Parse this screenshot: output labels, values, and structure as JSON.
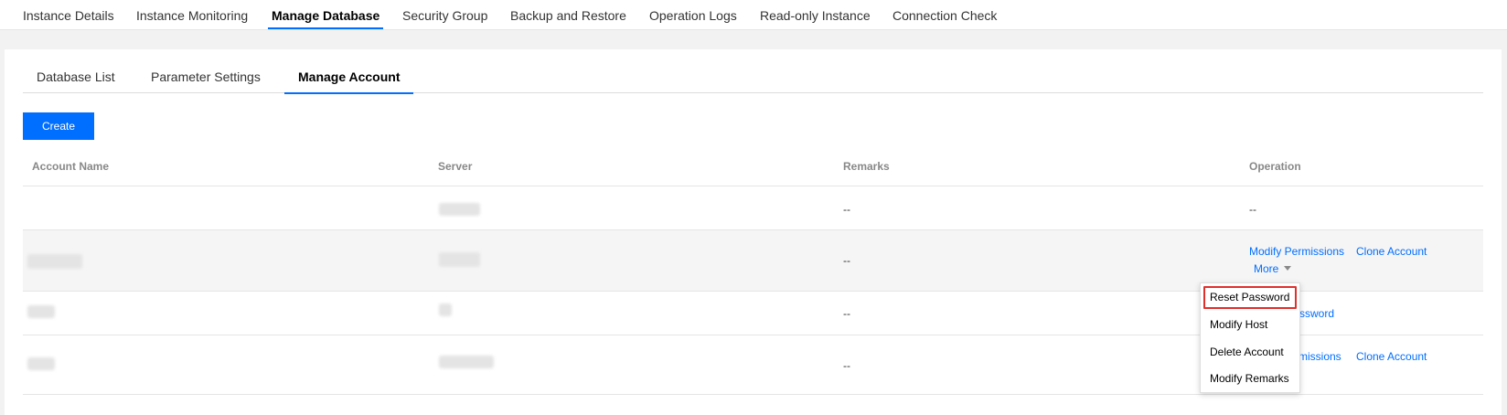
{
  "top_nav": {
    "tabs": [
      {
        "label": "Instance Details"
      },
      {
        "label": "Instance Monitoring"
      },
      {
        "label": "Manage Database"
      },
      {
        "label": "Security Group"
      },
      {
        "label": "Backup and Restore"
      },
      {
        "label": "Operation Logs"
      },
      {
        "label": "Read-only Instance"
      },
      {
        "label": "Connection Check"
      }
    ],
    "active": "Manage Database"
  },
  "sub_tabs": {
    "tabs": [
      {
        "label": "Database List"
      },
      {
        "label": "Parameter Settings"
      },
      {
        "label": "Manage Account"
      }
    ],
    "active": "Manage Account"
  },
  "create_button": "Create",
  "table": {
    "headers": [
      "Account Name",
      "Server",
      "Remarks",
      "Operation"
    ],
    "rows": [
      {
        "remarks": "--",
        "operation": "--"
      },
      {
        "remarks": "--",
        "actions": [
          "Modify Permissions",
          "Clone Account"
        ],
        "more": "More"
      },
      {
        "remarks": "--",
        "partial_action": "ssword"
      },
      {
        "remarks": "--",
        "partial_action": "rmissions",
        "clone": "Clone Account"
      }
    ]
  },
  "more_menu": {
    "items": [
      "Reset Password",
      "Modify Host",
      "Delete Account",
      "Modify Remarks"
    ],
    "highlighted": "Reset Password"
  },
  "colors": {
    "accent": "#006eff",
    "highlight_box": "#e0302b"
  }
}
